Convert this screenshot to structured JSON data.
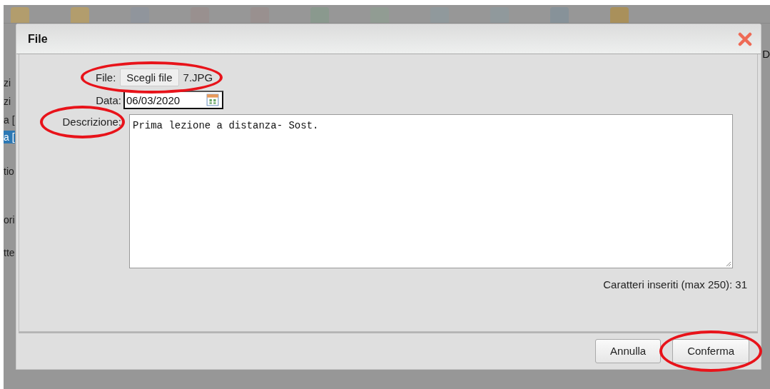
{
  "background": {
    "side_texts": [
      {
        "text": "zi",
        "selected": false
      },
      {
        "text": "zi",
        "selected": false
      },
      {
        "text": "a [",
        "selected": false
      },
      {
        "text": "a [",
        "selected": true
      },
      {
        "text": "tio",
        "selected": false
      },
      {
        "text": "ori",
        "selected": false
      },
      {
        "text": "tte",
        "selected": false
      }
    ],
    "right_text": "D"
  },
  "dialog": {
    "title": "File",
    "file": {
      "label": "File:",
      "button": "Scegli file",
      "filename": "7.JPG",
      "highlighted": true
    },
    "date": {
      "label": "Data:",
      "value": "06/03/2020"
    },
    "description": {
      "label": "Descrizione:",
      "value": "Prima lezione a distanza- Sost.",
      "highlighted": true
    },
    "counter": "Caratteri inseriti (max 250): 31",
    "buttons": [
      {
        "label": "Annulla",
        "highlighted": false
      },
      {
        "label": "Conferma",
        "highlighted": true
      }
    ]
  }
}
